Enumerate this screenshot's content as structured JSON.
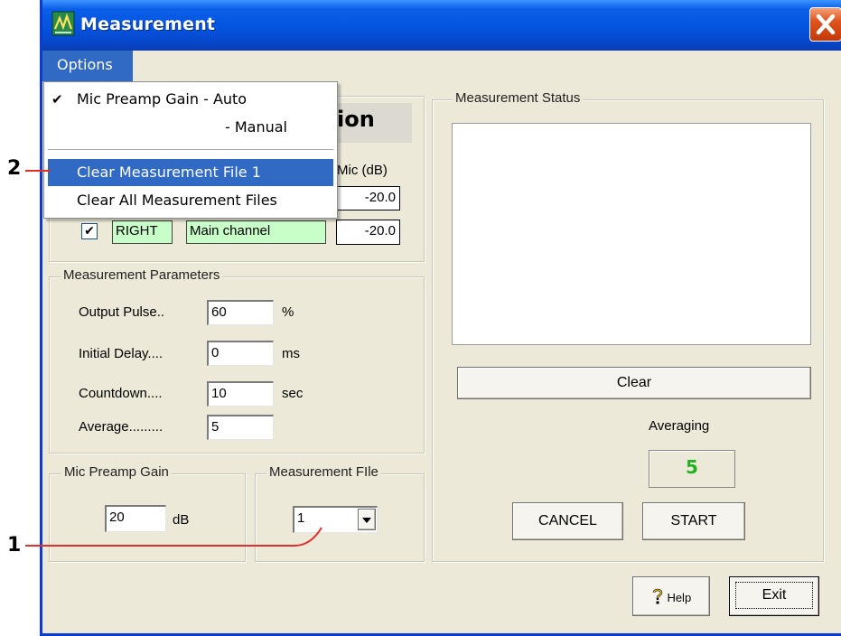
{
  "window": {
    "title": "Measurement",
    "menu": {
      "options_label": "Options"
    }
  },
  "options_menu": {
    "items": [
      {
        "label": "Mic Preamp Gain - Auto",
        "checked": true
      },
      {
        "label": "- Manual",
        "checked": false
      },
      {
        "label": "Clear Measurement File 1",
        "highlighted": true
      },
      {
        "label": "Clear All Measurement Files"
      }
    ]
  },
  "channel_section": {
    "title_partial": "ion",
    "mic_header": "Mic (dB)",
    "rows": [
      {
        "checked": true,
        "side": "",
        "name": "",
        "mic": "-20.0"
      },
      {
        "checked": true,
        "side": "RIGHT",
        "name": "Main channel",
        "mic": "-20.0"
      }
    ]
  },
  "measurement_parameters": {
    "legend": "Measurement Parameters",
    "rows": [
      {
        "label": "Output Pulse..",
        "value": "60",
        "unit": "%"
      },
      {
        "label": "Initial Delay....",
        "value": "0",
        "unit": "ms"
      },
      {
        "label": "Countdown....",
        "value": "10",
        "unit": "sec"
      },
      {
        "label": "Average.........",
        "value": "5",
        "unit": ""
      }
    ]
  },
  "mic_preamp_gain": {
    "legend": "Mic Preamp Gain",
    "value": "20",
    "unit": "dB"
  },
  "measurement_file": {
    "legend": "Measurement FIle",
    "selected": "1"
  },
  "measurement_status": {
    "legend": "Measurement Status",
    "clear_label": "Clear",
    "averaging_label": "Averaging",
    "averaging_value": "5",
    "cancel_label": "CANCEL",
    "start_label": "START"
  },
  "footer": {
    "help_label": "Help",
    "exit_label": "Exit"
  },
  "callouts": {
    "one": "1",
    "two": "2"
  },
  "colors": {
    "title_bar": "#0553e0",
    "menu_highlight": "#316ac5",
    "close_button": "#e0541c",
    "averaging_value": "#22b022",
    "input_green": "#c8ffc8",
    "callout_line": "#e0302c"
  }
}
